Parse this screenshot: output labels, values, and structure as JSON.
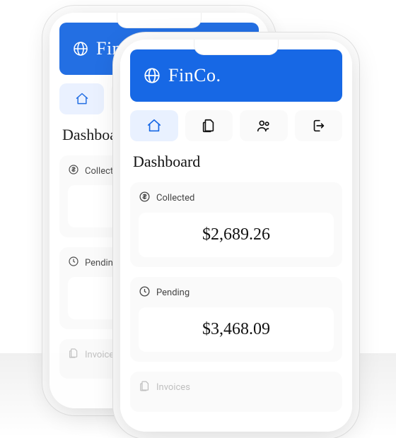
{
  "brand": "FinCo.",
  "nav": {
    "home": "home",
    "docs": "documents",
    "users": "users",
    "logout": "logout"
  },
  "page_title": "Dashboard",
  "cards": {
    "collected": {
      "label": "Collected",
      "value": "$2,689.26"
    },
    "pending": {
      "label": "Pending",
      "value": "$3,468.09"
    },
    "invoices": {
      "label": "Invoices"
    }
  },
  "colors": {
    "accent": "#1768e5",
    "nav_active_bg": "#e9f1ff",
    "card_bg": "#fafafa"
  }
}
